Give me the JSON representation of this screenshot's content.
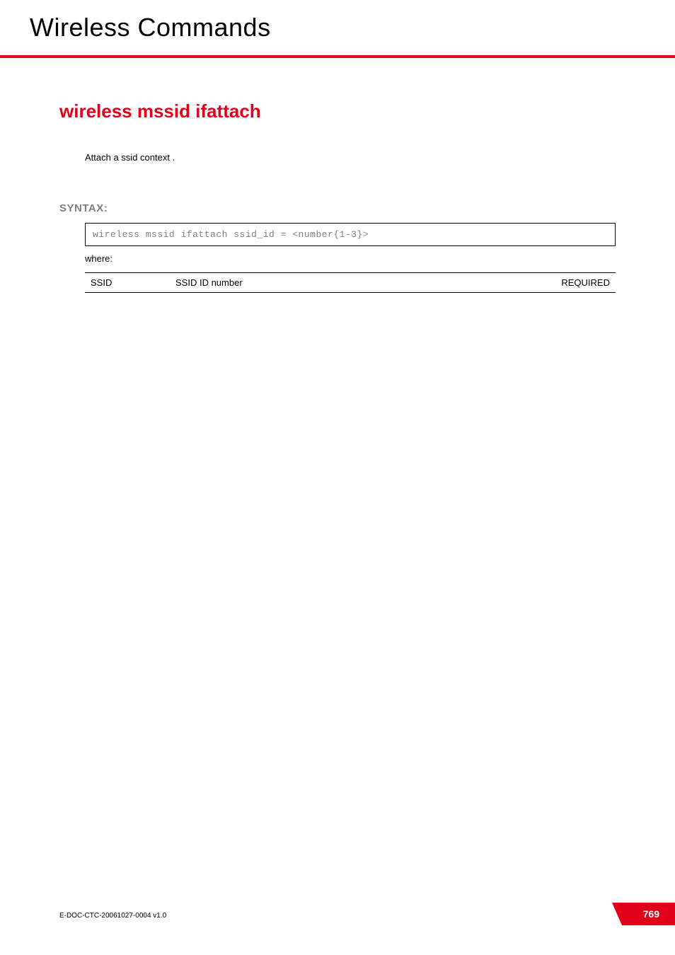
{
  "header": {
    "title": "Wireless Commands"
  },
  "command": {
    "title": "wireless mssid ifattach",
    "description": "Attach a ssid context ."
  },
  "syntax": {
    "label": "SYNTAX:",
    "code": "wireless mssid ifattach   ssid_id = <number{1-3}>",
    "where_label": "where:"
  },
  "params": [
    {
      "name": "SSID",
      "desc": "SSID ID number",
      "req": "REQUIRED"
    }
  ],
  "footer": {
    "doc": "E-DOC-CTC-20061027-0004 v1.0",
    "page": "769"
  }
}
